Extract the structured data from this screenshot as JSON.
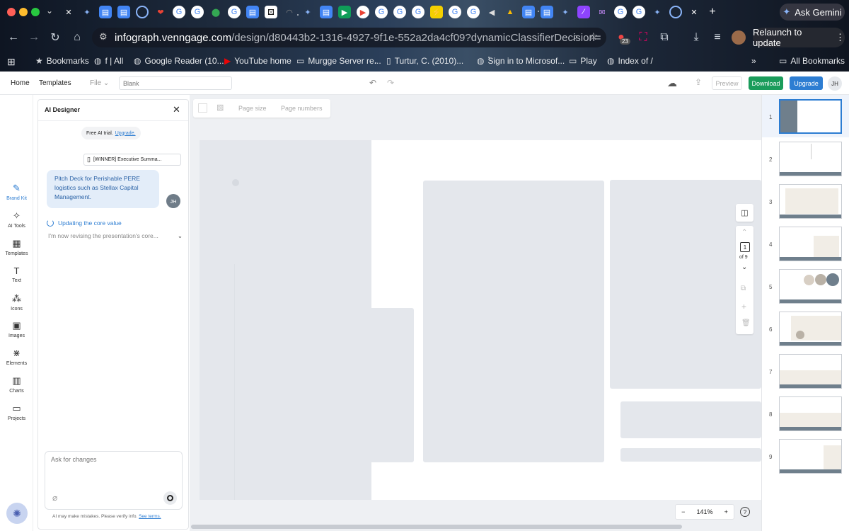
{
  "browser": {
    "gemini_label": "Ask Gemini",
    "url_host": "infograph.venngage.com",
    "url_path": "/design/d80443b2-1316-4927-9f1e-552a2da4cf09?dynamicClassifierDecision=",
    "relaunch_label": "Relaunch to update",
    "extension_badge": "23",
    "bookmarks": [
      {
        "label": "Bookmarks"
      },
      {
        "label": "f | All"
      },
      {
        "label": "Google Reader (10..."
      },
      {
        "label": "YouTube home"
      },
      {
        "label": "Murgge Server re..."
      },
      {
        "label": "Turtur, C. (2010)..."
      },
      {
        "label": "Sign in to Microsof..."
      },
      {
        "label": "Play"
      },
      {
        "label": "Index of /"
      }
    ],
    "all_bookmarks_label": "All Bookmarks"
  },
  "app": {
    "home": "Home",
    "templates": "Templates",
    "file": "File",
    "title_placeholder": "Blank",
    "preview": "Preview",
    "download": "Download",
    "upgrade": "Upgrade",
    "avatar": "JH",
    "accent": "#2d7dd2",
    "download_color": "#1a9c5b"
  },
  "rail": [
    {
      "label": "Brand Kit"
    },
    {
      "label": "AI Tools"
    },
    {
      "label": "Templates"
    },
    {
      "label": "Text"
    },
    {
      "label": "Icons"
    },
    {
      "label": "Images"
    },
    {
      "label": "Elements"
    },
    {
      "label": "Charts"
    },
    {
      "label": "Projects"
    }
  ],
  "ai_panel": {
    "title": "AI Designer",
    "trial_text": "Free AI trial.",
    "trial_link": "Upgrade.",
    "attachment": "[WINNER] Executive Summa...",
    "user_message": "Pitch Deck for Perishable PERE logistics such as Stellax Capital Management.",
    "user_avatar": "JH",
    "status": "Updating the core value",
    "status_detail": "I'm now revising the presentation's core...",
    "input_placeholder": "Ask for changes",
    "disclaimer": "AI may make mistakes. Please verify info.",
    "terms": "See terms."
  },
  "canvas_toolbar": {
    "page_size": "Page size",
    "page_numbers": "Page numbers"
  },
  "pager": {
    "current": "1",
    "total": "of 9"
  },
  "zoom": {
    "value": "141%",
    "minus": "−",
    "plus": "+"
  },
  "pages": [
    {
      "num": "1"
    },
    {
      "num": "2"
    },
    {
      "num": "3"
    },
    {
      "num": "4"
    },
    {
      "num": "5"
    },
    {
      "num": "6"
    },
    {
      "num": "7"
    },
    {
      "num": "8"
    },
    {
      "num": "9"
    }
  ]
}
